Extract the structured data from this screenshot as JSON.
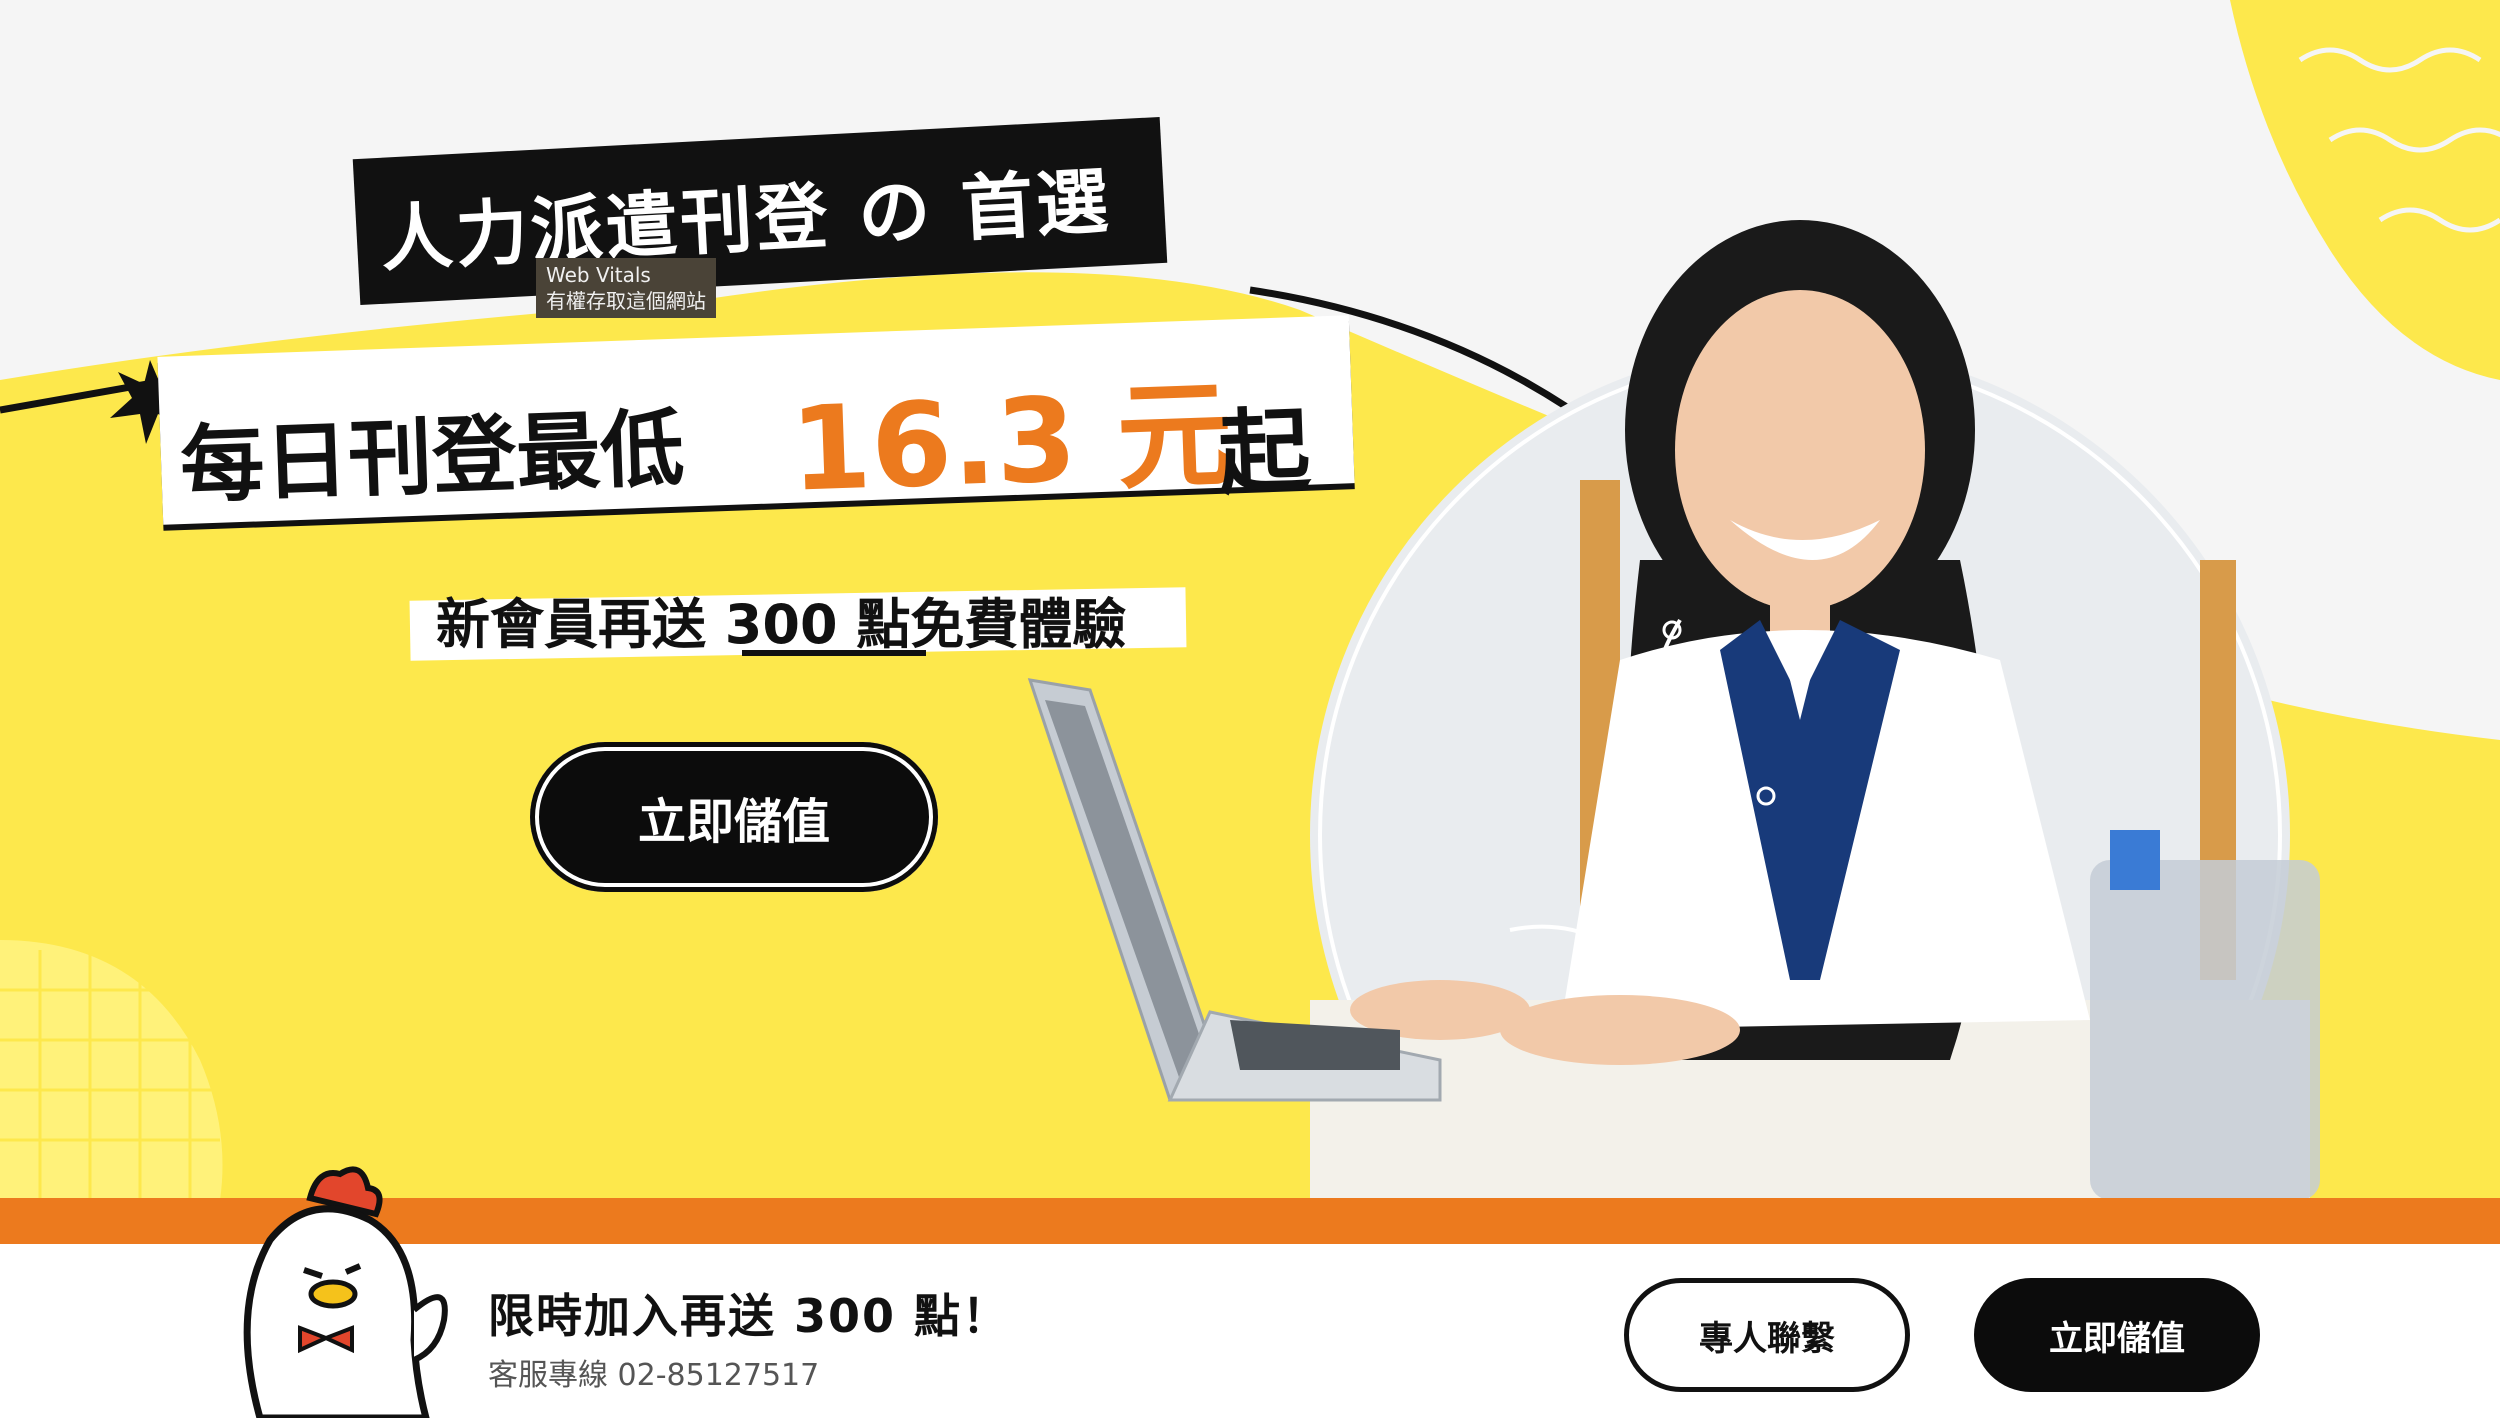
{
  "hero": {
    "headline": "人力派遣刊登 の 首選",
    "price_label": "每日刊登最低",
    "price_value": "16.3 元",
    "price_suffix": "起",
    "promo": "新會員再送 300 點免費體驗",
    "cta_label": "立即儲值"
  },
  "tooltip": {
    "text": "Web Vitals\n有權存取這個網站"
  },
  "bottom_bar": {
    "title": "限時加入再送 300 點！",
    "phone": "客服專線 02-85127517",
    "contact_label": "專人聯繫",
    "topup_label": "立即儲值"
  },
  "colors": {
    "accent_yellow": "#fde84c",
    "accent_orange": "#ec7a1e",
    "dark": "#0c0c0c"
  },
  "icons": {
    "mascot": "chicken-mascot",
    "sparkle": "starburst-icon"
  }
}
